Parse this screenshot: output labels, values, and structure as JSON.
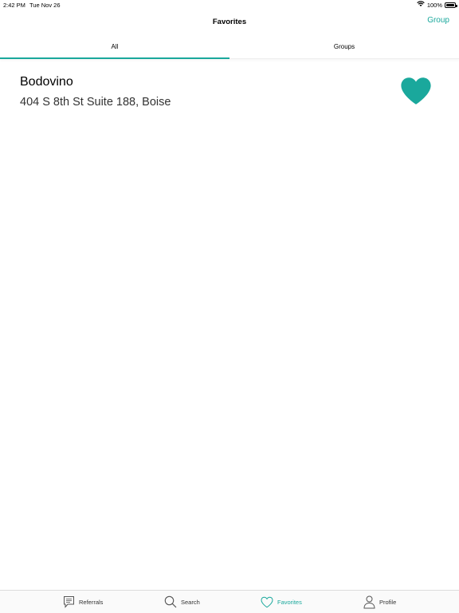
{
  "status_bar": {
    "time": "2:42 PM",
    "date": "Tue Nov 26",
    "battery": "100%"
  },
  "nav": {
    "title": "Favorites",
    "action_label": "Group"
  },
  "segments": [
    {
      "label": "All",
      "selected": true
    },
    {
      "label": "Groups",
      "selected": false
    }
  ],
  "favorites": [
    {
      "name": "Bodovino",
      "address": "404 S 8th St Suite 188, Boise",
      "favorited": true
    }
  ],
  "tabs": [
    {
      "label": "Referrals",
      "icon": "chat-bubble-icon",
      "active": false
    },
    {
      "label": "Search",
      "icon": "search-icon",
      "active": false
    },
    {
      "label": "Favorites",
      "icon": "heart-icon",
      "active": true
    },
    {
      "label": "Profile",
      "icon": "person-icon",
      "active": false
    }
  ],
  "colors": {
    "accent": "#1aa89c"
  }
}
